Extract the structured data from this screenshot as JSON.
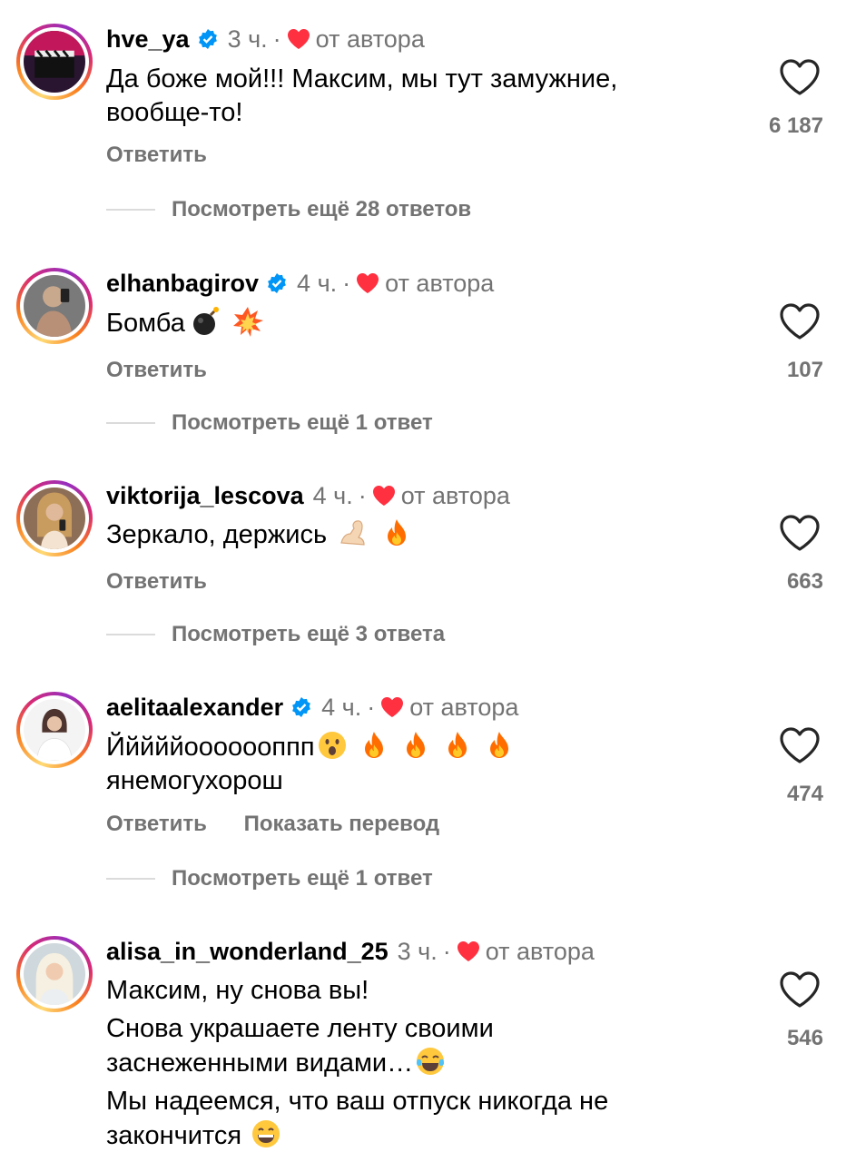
{
  "comments": [
    {
      "username": "hve_ya",
      "verified": true,
      "time": "3 ч.",
      "author_label": "от автора",
      "text_lines": [
        "Да боже мой!!! Максим, мы тут замужние,",
        "вообще-то!"
      ],
      "likes": "6 187",
      "actions": [
        "Ответить"
      ],
      "replies": "Посмотреть ещё 28 ответов"
    },
    {
      "username": "elhanbagirov",
      "verified": true,
      "time": "4 ч.",
      "author_label": "от автора",
      "text": "Бомба",
      "emojis": [
        "bomb",
        "collision"
      ],
      "likes": "107",
      "actions": [
        "Ответить"
      ],
      "replies": "Посмотреть ещё 1 ответ"
    },
    {
      "username": "viktorija_lescova",
      "verified": false,
      "time": "4 ч.",
      "author_label": "от автора",
      "text": "Зеркало, держись",
      "emojis": [
        "flexed-biceps",
        "fire"
      ],
      "likes": "663",
      "actions": [
        "Ответить"
      ],
      "replies": "Посмотреть ещё 3 ответа"
    },
    {
      "username": "aelitaalexander",
      "verified": true,
      "time": "4 ч.",
      "author_label": "от автора",
      "text": "Йййййооооооппп",
      "emojis": [
        "astonished-face",
        "fire",
        "fire",
        "fire",
        "fire"
      ],
      "text_line2": "янемогухорош",
      "likes": "474",
      "actions": [
        "Ответить",
        "Показать перевод"
      ],
      "replies": "Посмотреть ещё 1 ответ"
    },
    {
      "username": "alisa_in_wonderland_25",
      "verified": false,
      "time": "3 ч.",
      "author_label": "от автора",
      "paragraph1": "Максим, ну снова вы!",
      "paragraph2_line1": "Снова украшаете ленту своими",
      "paragraph2_line2": "заснеженными видами…",
      "paragraph2_emoji": "face-with-tears-of-joy",
      "paragraph3_line1": "Мы надеемся, что ваш отпуск никогда не",
      "paragraph3_line2": "закончится",
      "paragraph3_emoji": "grinning-face",
      "likes": "546"
    }
  ],
  "icons": {
    "verified": "verified-badge-icon",
    "author_heart": "heart-filled-icon",
    "like": "heart-outline-icon"
  },
  "colors": {
    "verified_blue": "#0095f6",
    "author_heart_red": "#ff3040",
    "secondary_text": "#737373"
  }
}
